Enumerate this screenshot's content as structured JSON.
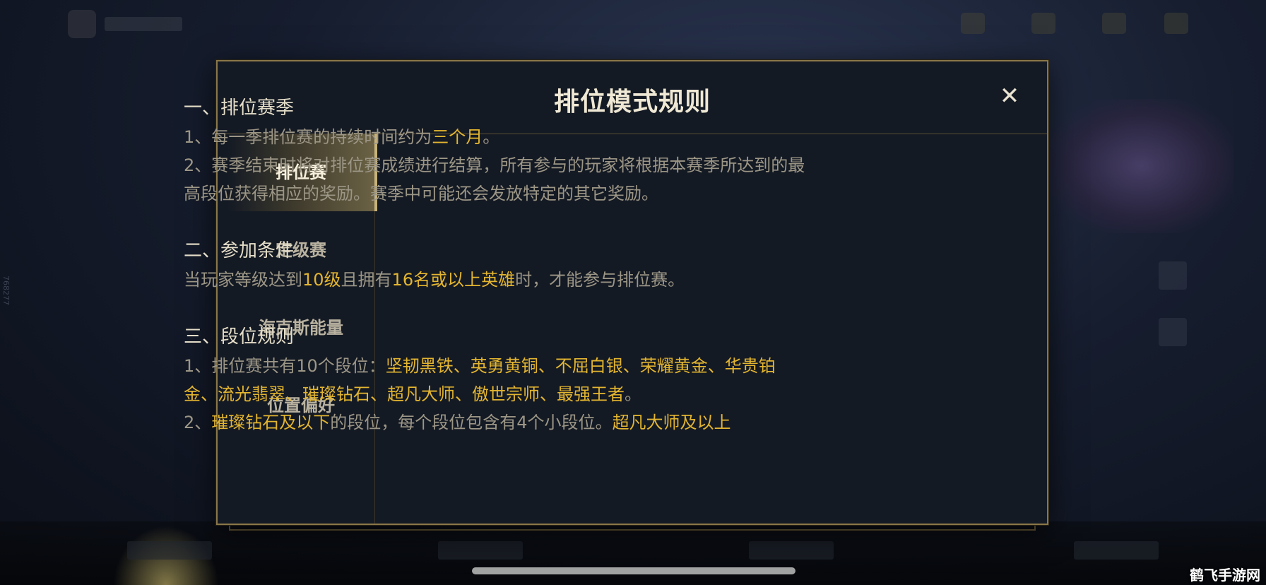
{
  "background": {
    "watermark": "鹤飞手游网",
    "side_id_text": "768277"
  },
  "modal": {
    "title": "排位模式规则",
    "close_label": "✕"
  },
  "sidebar": {
    "tabs": [
      {
        "label": "排位赛",
        "active": true
      },
      {
        "label": "定级赛",
        "active": false
      },
      {
        "label": "海克斯能量",
        "active": false
      },
      {
        "label": "位置偏好",
        "active": false
      }
    ]
  },
  "content": {
    "s1": {
      "title": "一、排位赛季",
      "l1_a": "1、每一季排位赛的持续时间约为",
      "l1_hl": "三个月",
      "l1_b": "。",
      "l2": "2、赛季结束时将对排位赛成绩进行结算，所有参与的玩家将根据本赛季所达到的最高段位获得相应的奖励。赛季中可能还会发放特定的其它奖励。"
    },
    "s2": {
      "title": "二、参加条件",
      "a": "当玩家等级达到",
      "hl1": "10级",
      "b": "且拥有",
      "hl2": "16名或以上英雄",
      "c": "时，才能参与排位赛。"
    },
    "s3": {
      "title": "三、段位规则",
      "l1_a": "1、排位赛共有10个段位：",
      "l1_hl": "坚韧黑铁、英勇黄铜、不屈白银、荣耀黄金、华贵铂金、流光翡翠、璀璨钻石、超凡大师、傲世宗师、最强王者",
      "l1_b": "。",
      "l2_a": "2、",
      "l2_hl1": "璀璨钻石及以下",
      "l2_b": "的段位，每个段位包含有4个小段位。",
      "l2_hl2": "超凡大师及以上"
    }
  },
  "colors": {
    "highlight": "#e3b530",
    "border_gold": "#8a7748",
    "modal_bg": "#141a24"
  }
}
